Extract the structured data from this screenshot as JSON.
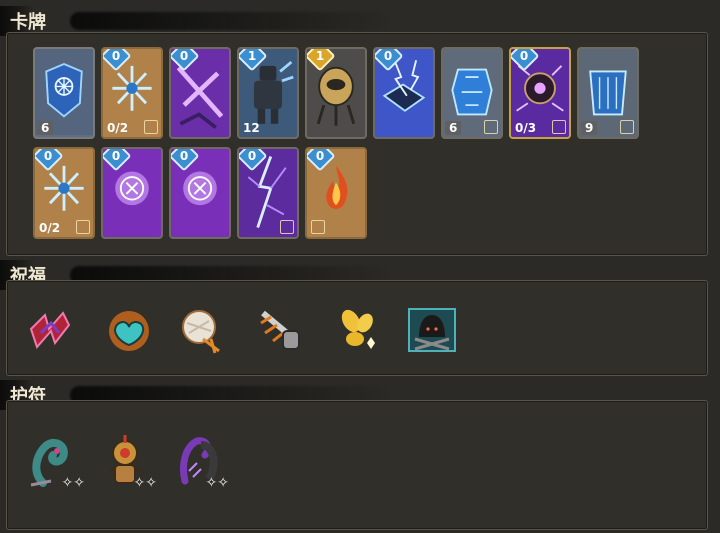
{
  "sections": {
    "cards": {
      "title": "卡牌"
    },
    "blessings": {
      "title": "祝福"
    },
    "charms": {
      "title": "护符"
    }
  },
  "cards": [
    {
      "name": "frost-shield-card",
      "cost": "",
      "stat": "6",
      "border": "gray"
    },
    {
      "name": "snowflake-card",
      "cost": "0",
      "stat": "0/2",
      "border": "orange"
    },
    {
      "name": "purple-slash-card",
      "cost": "0",
      "stat": "",
      "border": "gray"
    },
    {
      "name": "dark-knight-card",
      "cost": "1",
      "stat": "12",
      "border": "gray"
    },
    {
      "name": "golden-golem-card",
      "cost": "1",
      "cost_color": "gold",
      "stat": "",
      "border": "gray"
    },
    {
      "name": "lightning-trap-card",
      "cost": "0",
      "stat": "",
      "border": "gray"
    },
    {
      "name": "ice-armor-card",
      "cost": "",
      "stat": "6",
      "border": "gray"
    },
    {
      "name": "void-orb-card",
      "cost": "0",
      "stat": "0/3",
      "border": "gold"
    },
    {
      "name": "ice-wall-card",
      "cost": "",
      "stat": "9",
      "border": "gray"
    },
    {
      "name": "snowflake-card-2",
      "cost": "0",
      "stat": "0/2",
      "border": "orange"
    },
    {
      "name": "arcane-rune-card",
      "cost": "0",
      "stat": "",
      "border": "gray"
    },
    {
      "name": "arcane-rune-card-2",
      "cost": "0",
      "stat": "",
      "border": "gray"
    },
    {
      "name": "purple-lightning-card",
      "cost": "0",
      "stat": "",
      "border": "gray"
    },
    {
      "name": "fire-card",
      "cost": "0",
      "stat": "",
      "border": "orange"
    }
  ],
  "blessings": [
    {
      "name": "crimson-sigil-icon"
    },
    {
      "name": "flaming-heart-icon"
    },
    {
      "name": "white-orb-icon"
    },
    {
      "name": "drill-hand-icon"
    },
    {
      "name": "golden-petals-icon"
    },
    {
      "name": "hooded-figure-icon"
    }
  ],
  "charms": [
    {
      "name": "serpent-charm-icon"
    },
    {
      "name": "voodoo-doll-charm-icon"
    },
    {
      "name": "void-claw-charm-icon"
    }
  ],
  "colors": {
    "background": "#2b2a26",
    "panel": "#302f2a",
    "panel_border": "#5b5547",
    "cost_blue": "#3b8fd0",
    "cost_gold": "#d9a52a"
  }
}
